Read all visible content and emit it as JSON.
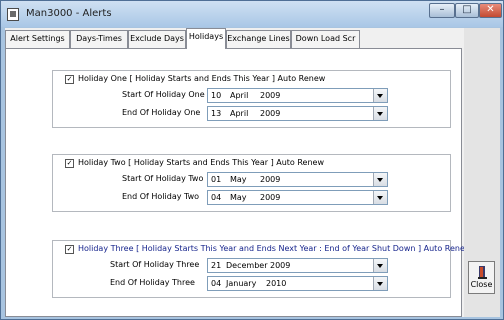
{
  "window": {
    "title": "Man3000  - Alerts",
    "minimize_glyph": "–",
    "maximize_glyph": "□",
    "close_glyph": "✕"
  },
  "tabs": [
    {
      "label": "Alert Settings"
    },
    {
      "label": "Days-Times"
    },
    {
      "label": "Exclude Days"
    },
    {
      "label": "Holidays",
      "active": true
    },
    {
      "label": "Exchange Lines"
    },
    {
      "label": "Down Load Scr"
    }
  ],
  "holidays": [
    {
      "checked": "✓",
      "title": "Holiday One  [ Holiday Starts and Ends This Year ] Auto Renew",
      "start_label": "Start Of Holiday One",
      "start": {
        "day": "10",
        "month": "April",
        "year": "2009"
      },
      "end_label": "End Of Holiday One",
      "end": {
        "day": "13",
        "month": "April",
        "year": "2009"
      }
    },
    {
      "checked": "✓",
      "title": "Holiday Two  [ Holiday Starts and Ends This Year ] Auto Renew",
      "start_label": "Start Of Holiday Two",
      "start": {
        "day": "01",
        "month": "May",
        "year": "2009"
      },
      "end_label": "End Of Holiday Two",
      "end": {
        "day": "04",
        "month": "May",
        "year": "2009"
      }
    },
    {
      "checked": "✓",
      "title": "Holiday Three  [ Holiday Starts This Year and Ends Next Year : End of Year Shut Down ] Auto Renew",
      "start_label": "Start Of Holiday Three",
      "start": {
        "day": "21",
        "month": "December",
        "year": "2009"
      },
      "end_label": "End Of Holiday Three",
      "end": {
        "day": "04",
        "month": "January",
        "year": "2010"
      }
    }
  ],
  "sidebar": {
    "close_label": "Close"
  },
  "colors": {
    "title_blue": "#16248c",
    "window_frame": "#a8c4e0"
  }
}
